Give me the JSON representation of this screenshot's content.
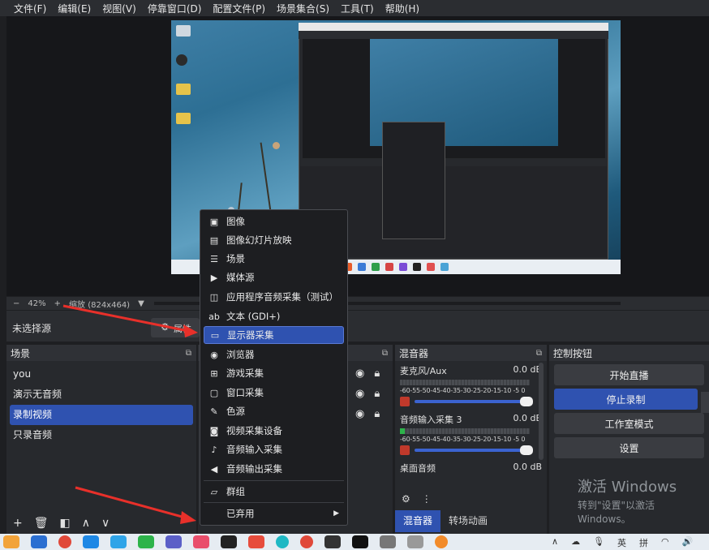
{
  "menubar": [
    "文件(F)",
    "编辑(E)",
    "视图(V)",
    "停靠窗口(D)",
    "配置文件(P)",
    "场景集合(S)",
    "工具(T)",
    "帮助(H)"
  ],
  "zoom": {
    "minus": "−",
    "value": "42%",
    "plus": "+",
    "label": "缩放 (824x464)",
    "dropdown": "▼"
  },
  "source_bar": {
    "no_source": "未选择源",
    "properties": "属性"
  },
  "scenes": {
    "title": "场景",
    "items": [
      "you",
      "演示无音频",
      "录制视频",
      "只录音频"
    ],
    "selected_index": 2,
    "tools": [
      "+",
      "🗑",
      "◧",
      "∧",
      "∨"
    ]
  },
  "context_menu": {
    "items": [
      {
        "icon": "image-icon",
        "glyph": "▣",
        "label": "图像"
      },
      {
        "icon": "slideshow-icon",
        "glyph": "▤",
        "label": "图像幻灯片放映"
      },
      {
        "icon": "scene-list-icon",
        "glyph": "☰",
        "label": "场景"
      },
      {
        "icon": "media-play-icon",
        "glyph": "▶",
        "label": "媒体源"
      },
      {
        "icon": "app-audio-icon",
        "glyph": "◫",
        "label": "应用程序音频采集（测试）"
      },
      {
        "icon": "text-icon",
        "glyph": "ab",
        "label": "文本 (GDI+)"
      },
      {
        "icon": "monitor-icon",
        "glyph": "▭",
        "label": "显示器采集"
      },
      {
        "icon": "globe-icon",
        "glyph": "◉",
        "label": "浏览器"
      },
      {
        "icon": "gamepad-icon",
        "glyph": "⊞",
        "label": "游戏采集"
      },
      {
        "icon": "window-icon",
        "glyph": "▢",
        "label": "窗口采集"
      },
      {
        "icon": "brush-icon",
        "glyph": "✎",
        "label": "色源"
      },
      {
        "icon": "camera-icon",
        "glyph": "◙",
        "label": "视频采集设备"
      },
      {
        "icon": "microphone-icon",
        "glyph": "♪",
        "label": "音频输入采集"
      },
      {
        "icon": "speaker-icon",
        "glyph": "◀",
        "label": "音频输出采集"
      },
      {
        "icon": "folder-icon",
        "glyph": "▱",
        "label": "群组"
      },
      {
        "icon": "chevron-right-icon",
        "glyph": "",
        "label": "已弃用"
      }
    ],
    "highlighted_index": 6,
    "submenu_arrow": "▶"
  },
  "mixer": {
    "title": "混音器",
    "channels": [
      {
        "name": "麦克风/Aux",
        "db": "0.0 dB"
      },
      {
        "name": "音频输入采集 3",
        "db": "0.0 dB"
      },
      {
        "name": "桌面音频",
        "db": "0.0 dB"
      }
    ],
    "scale": "-60-55-50-45-40-35-30-25-20-15-10 -5  0",
    "tabs": [
      "混音器",
      "转场动画"
    ]
  },
  "controls": {
    "title": "控制按钮",
    "buttons": [
      "开始直播",
      "停止录制",
      "工作室模式",
      "设置"
    ]
  },
  "activate": {
    "line1": "激活 Windows",
    "line2": "转到\"设置\"以激活 Windows。"
  },
  "tray": [
    "∧",
    "☁",
    "🎙",
    "英",
    "拼",
    "◠",
    "🔊"
  ],
  "colors": {
    "accent": "#2f52b0",
    "panel": "#27292d",
    "arrow": "#e8302a"
  }
}
